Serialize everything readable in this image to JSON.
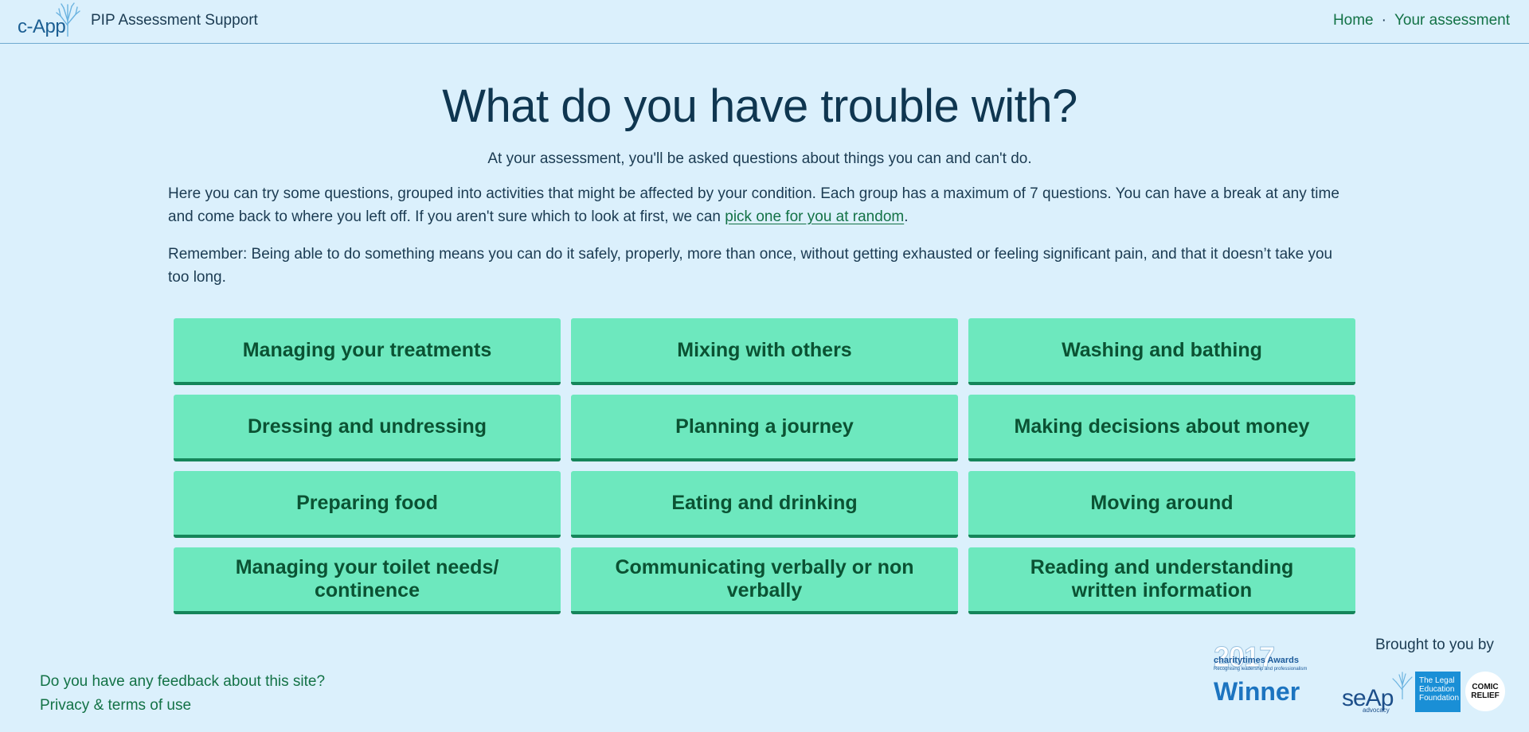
{
  "header": {
    "logo_text": "c-App",
    "site_title": "PIP Assessment Support",
    "nav": [
      {
        "label": "Home"
      },
      {
        "label": "Your assessment"
      }
    ],
    "nav_separator": "·"
  },
  "main": {
    "heading": "What do you have trouble with?",
    "intro": "At your assessment, you'll be asked questions about things you can and can't do.",
    "paragraph_1_before_link": "Here you can try some questions, grouped into activities that might be affected by your condition. Each group has a maximum of 7 questions. You can have a break at any time and come back to where you left off. If you aren't sure which to look at first, we can ",
    "paragraph_1_link": "pick one for you at random",
    "paragraph_1_after_link": ".",
    "paragraph_2": "Remember: Being able to do something means you can do it safely, properly, more than once, without getting exhausted or feeling significant pain, and that it doesn’t take you too long."
  },
  "activities": [
    {
      "label": "Managing your treatments"
    },
    {
      "label": "Mixing with others"
    },
    {
      "label": "Washing and bathing"
    },
    {
      "label": "Dressing and undressing"
    },
    {
      "label": "Planning a journey"
    },
    {
      "label": "Making decisions about money"
    },
    {
      "label": "Preparing food"
    },
    {
      "label": "Eating and drinking"
    },
    {
      "label": "Moving around"
    },
    {
      "label": "Managing your toilet needs/ continence"
    },
    {
      "label": "Communicating verbally or non verbally"
    },
    {
      "label": "Reading and understanding written information"
    }
  ],
  "footer": {
    "feedback_link": "Do you have any feedback about this site?",
    "privacy_link": "Privacy & terms of use",
    "brought_to_you": "Brought to you by",
    "award": {
      "year": "2017",
      "brand": "charitytimes Awards",
      "tagline": "Recognising leadership and professionalism",
      "result": "Winner"
    },
    "partners": {
      "seap": "seAp",
      "seap_sub": "advocacy",
      "lef": "The Legal Education Foundation",
      "comic": "COMIC RELIEF"
    }
  },
  "colors": {
    "background": "#dbf0fc",
    "tile": "#6de8be",
    "tile_border": "#15855a",
    "tile_text": "#0b5233",
    "link": "#137246"
  },
  "icons": {
    "logo": "tree-icon"
  }
}
